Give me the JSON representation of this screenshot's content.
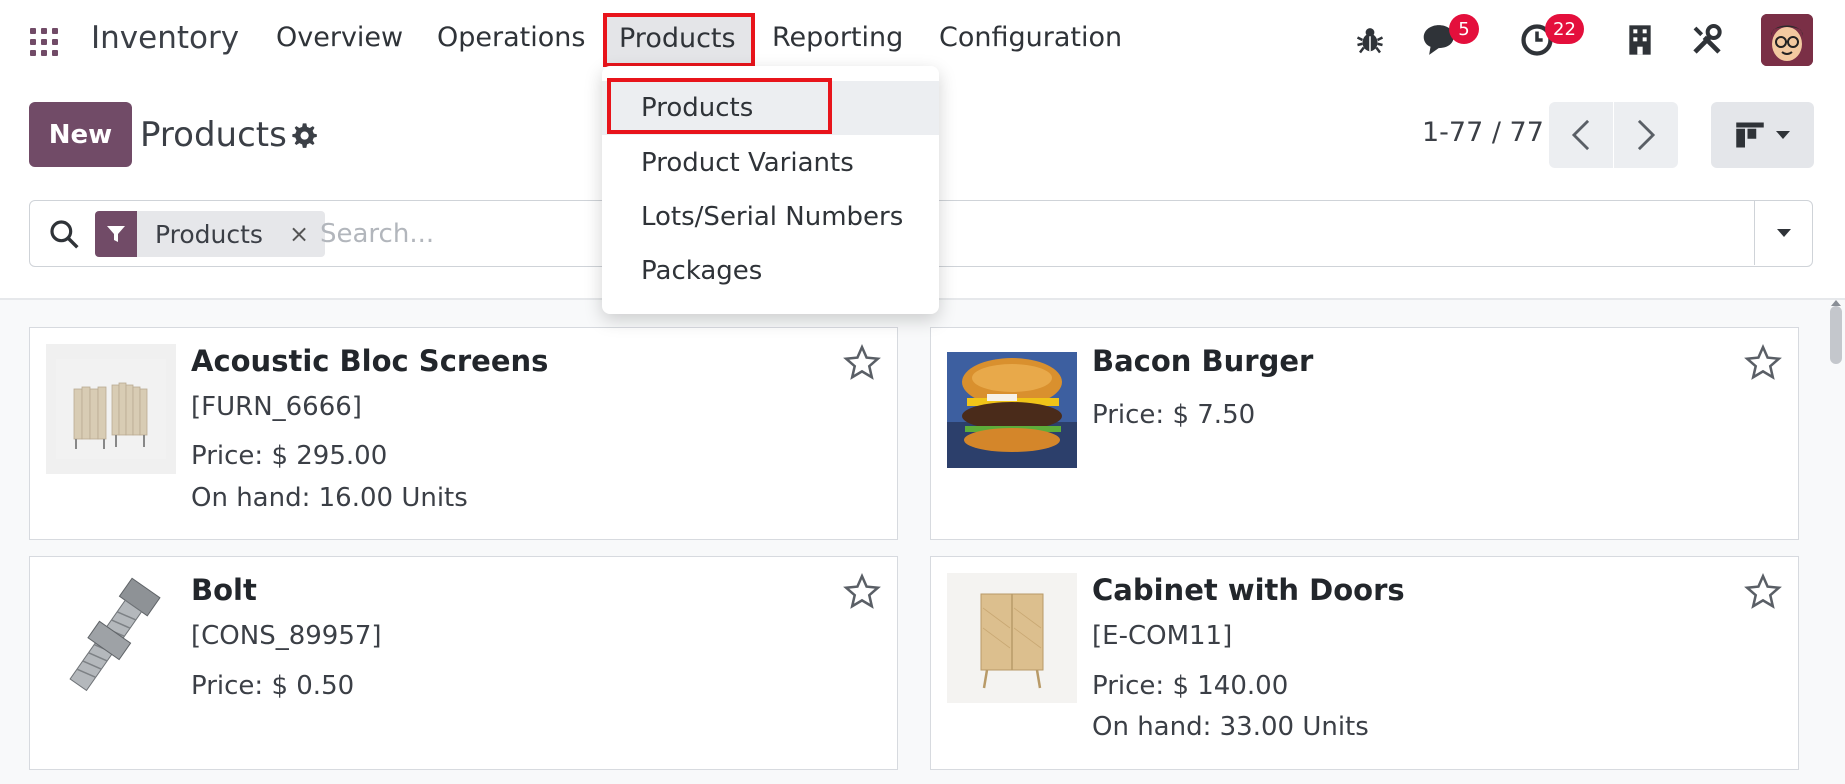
{
  "navbar": {
    "app_name": "Inventory",
    "menu": [
      "Overview",
      "Operations",
      "Products",
      "Reporting",
      "Configuration"
    ],
    "messages_count": "5",
    "activities_count": "22",
    "icons": [
      "apps-grid-icon",
      "bug-icon",
      "chat-icon",
      "clock-icon",
      "building-icon",
      "tools-icon",
      "avatar"
    ]
  },
  "control_panel": {
    "new_label": "New",
    "title": "Products",
    "pager": "1-77 / 77"
  },
  "search": {
    "facet_label": "Products",
    "facet_close": "×",
    "placeholder": "Search..."
  },
  "dropdown": {
    "items": [
      "Products",
      "Product Variants",
      "Lots/Serial Numbers",
      "Packages"
    ],
    "active_index": 0
  },
  "cards": [
    {
      "name": "Acoustic Bloc Screens",
      "ref": "[FURN_6666]",
      "price": "Price: $ 295.00",
      "on_hand": "On hand: 16.00 Units",
      "image": "acoustic-screens-image"
    },
    {
      "name": "Bacon Burger",
      "price": "Price: $ 7.50",
      "image": "burger-image"
    },
    {
      "name": "Bolt",
      "ref": "[CONS_89957]",
      "price": "Price: $ 0.50",
      "image": "bolt-image"
    },
    {
      "name": "Cabinet with Doors",
      "ref": "[E-COM11]",
      "price": "Price: $ 140.00",
      "on_hand": "On hand: 33.00 Units",
      "image": "cabinet-image"
    }
  ],
  "colors": {
    "brand": "#714b67",
    "badge": "#e40f3c",
    "highlight": "#e8141b"
  }
}
